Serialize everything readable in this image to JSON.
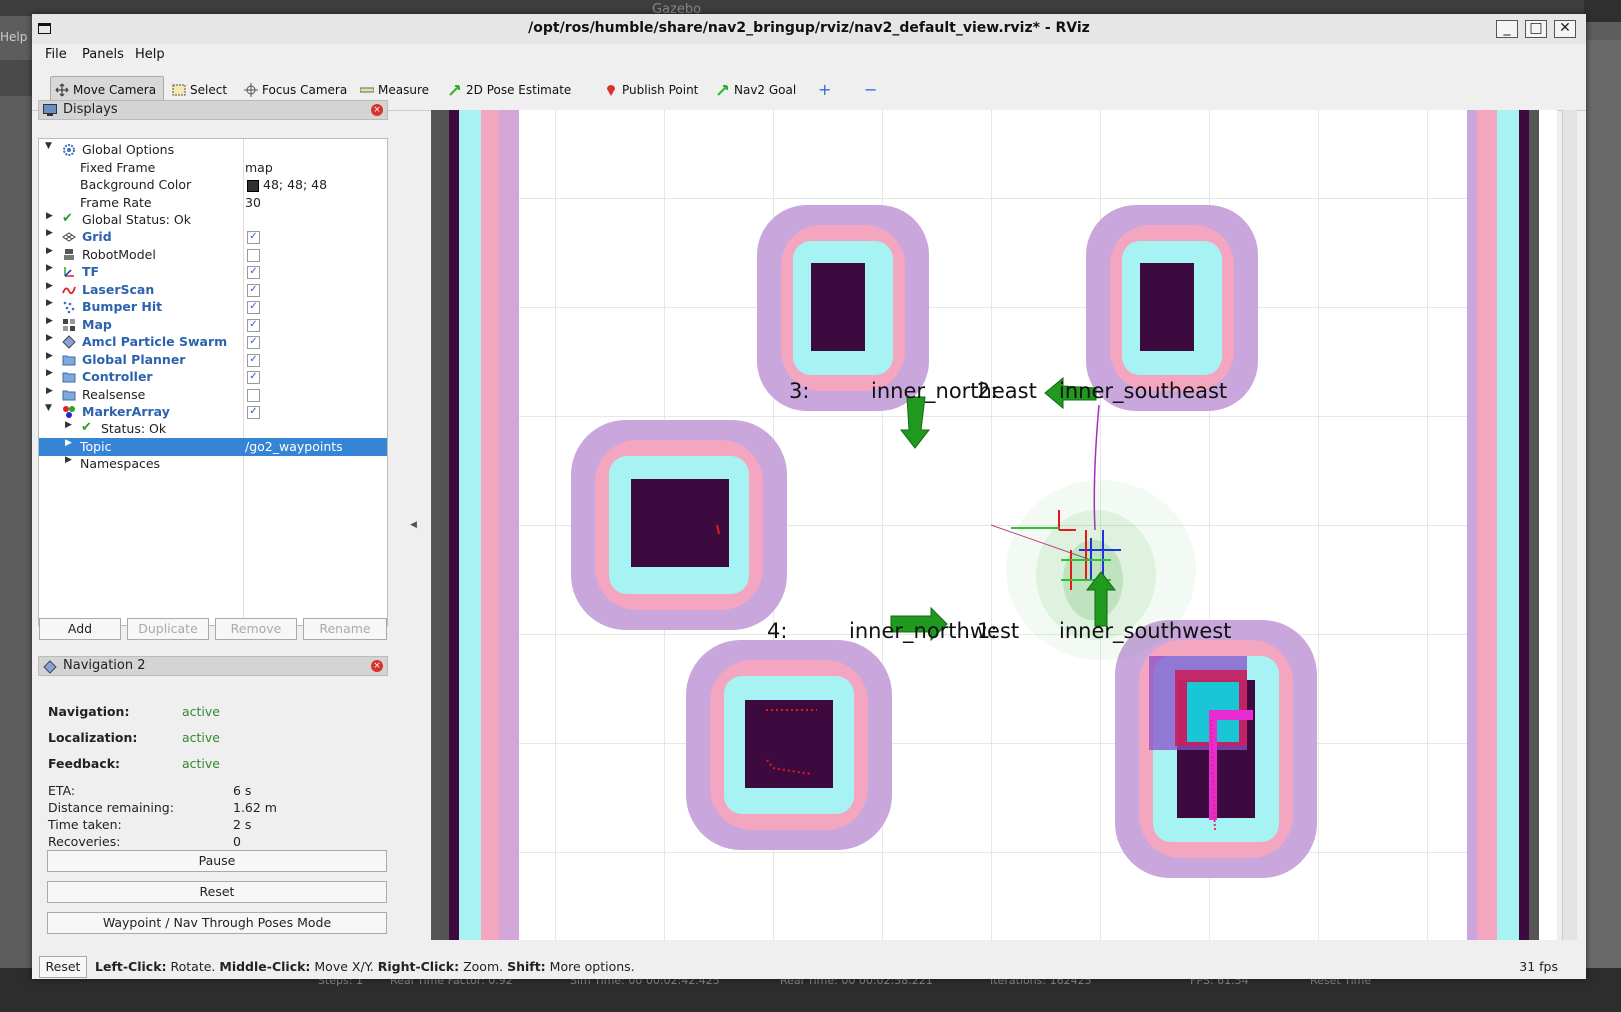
{
  "background": {
    "gazebo_title": "Gazebo",
    "gazebo_help": "Help",
    "gazebo_footer": [
      "Steps: 1",
      "Real Time Factor: 0.92",
      "Sim Time: 00 00:02:42.425",
      "Real Time: 00 00:02:58.221",
      "Iterations: 162425",
      "FPS: 61.54",
      "Reset Time"
    ]
  },
  "window": {
    "title": "/opt/ros/humble/share/nav2_bringup/rviz/nav2_default_view.rviz* - RViz",
    "minimize": "_",
    "maximize": "□",
    "close": "✕"
  },
  "menubar": {
    "file": "File",
    "panels": "Panels",
    "help": "Help"
  },
  "toolbar": {
    "move_camera": "Move Camera",
    "select": "Select",
    "focus_camera": "Focus Camera",
    "measure": "Measure",
    "pose_estimate": "2D Pose Estimate",
    "publish_point": "Publish Point",
    "nav2_goal": "Nav2 Goal",
    "add": "+",
    "remove": "−"
  },
  "displays": {
    "title": "Displays",
    "global_options": "Global Options",
    "fixed_frame_label": "Fixed Frame",
    "fixed_frame_value": "map",
    "bg_color_label": "Background Color",
    "bg_color_value": "48; 48; 48",
    "frame_rate_label": "Frame Rate",
    "frame_rate_value": "30",
    "global_status": "Global Status: Ok",
    "items": [
      {
        "name": "Grid",
        "checked": true,
        "highlight": true
      },
      {
        "name": "RobotModel",
        "checked": false,
        "highlight": false
      },
      {
        "name": "TF",
        "checked": true,
        "highlight": true
      },
      {
        "name": "LaserScan",
        "checked": true,
        "highlight": true
      },
      {
        "name": "Bumper Hit",
        "checked": true,
        "highlight": true
      },
      {
        "name": "Map",
        "checked": true,
        "highlight": true
      },
      {
        "name": "Amcl Particle Swarm",
        "checked": true,
        "highlight": true
      },
      {
        "name": "Global Planner",
        "checked": true,
        "highlight": true
      },
      {
        "name": "Controller",
        "checked": true,
        "highlight": true
      },
      {
        "name": "Realsense",
        "checked": false,
        "highlight": false
      },
      {
        "name": "MarkerArray",
        "checked": true,
        "highlight": true
      }
    ],
    "marker_status": "Status: Ok",
    "topic_label": "Topic",
    "topic_value": "/go2_waypoints",
    "namespaces": "Namespaces",
    "buttons": {
      "add": "Add",
      "duplicate": "Duplicate",
      "remove": "Remove",
      "rename": "Rename"
    }
  },
  "navigation": {
    "title": "Navigation 2",
    "navigation_label": "Navigation:",
    "navigation_value": "active",
    "localization_label": "Localization:",
    "localization_value": "active",
    "feedback_label": "Feedback:",
    "feedback_value": "active",
    "eta_label": "ETA:",
    "eta_value": "6 s",
    "distance_label": "Distance remaining:",
    "distance_value": "1.62 m",
    "time_label": "Time taken:",
    "time_value": "2 s",
    "recoveries_label": "Recoveries:",
    "recoveries_value": "0",
    "pause": "Pause",
    "reset": "Reset",
    "waypoint_mode": "Waypoint / Nav Through Poses Mode"
  },
  "viewport": {
    "markers": [
      {
        "id": "3:",
        "name": "inner_northeast"
      },
      {
        "id": "2:",
        "name": "inner_southeast"
      },
      {
        "id": "4:",
        "name": "inner_northwest"
      },
      {
        "id": "1:",
        "name": "inner_southwest"
      }
    ]
  },
  "statusbar": {
    "reset": "Reset",
    "hint_left": "Left-Click:",
    "hint_left_text": " Rotate. ",
    "hint_middle": "Middle-Click:",
    "hint_middle_text": " Move X/Y. ",
    "hint_right": "Right-Click:",
    "hint_right_text": " Zoom. ",
    "hint_shift": "Shift:",
    "hint_shift_text": " More options.",
    "fps": "31 fps"
  }
}
